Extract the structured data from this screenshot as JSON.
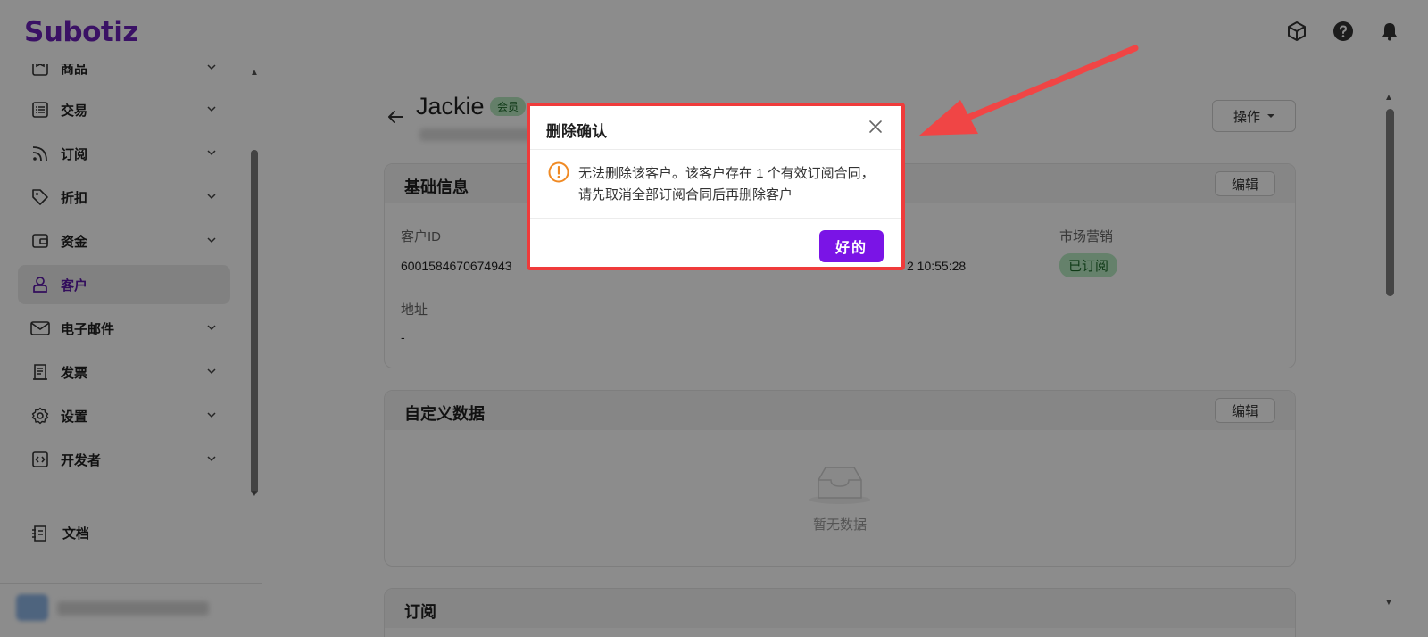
{
  "app": {
    "logo": "Subotiz"
  },
  "sidebar": {
    "items": [
      {
        "key": "products",
        "label": "商品",
        "icon": "product-icon"
      },
      {
        "key": "transactions",
        "label": "交易",
        "icon": "list-icon"
      },
      {
        "key": "subscriptions",
        "label": "订阅",
        "icon": "rss-icon"
      },
      {
        "key": "discounts",
        "label": "折扣",
        "icon": "tag-icon"
      },
      {
        "key": "funds",
        "label": "资金",
        "icon": "wallet-icon"
      },
      {
        "key": "customers",
        "label": "客户",
        "icon": "user-icon",
        "active": true
      },
      {
        "key": "email",
        "label": "电子邮件",
        "icon": "mail-icon"
      },
      {
        "key": "invoices",
        "label": "发票",
        "icon": "invoice-icon"
      },
      {
        "key": "settings",
        "label": "设置",
        "icon": "gear-icon"
      },
      {
        "key": "developer",
        "label": "开发者",
        "icon": "code-icon"
      }
    ],
    "docs_label": "文档"
  },
  "customer": {
    "name": "Jackie",
    "member_tag": "会员",
    "ops_label": "操作"
  },
  "basic_info": {
    "title": "基础信息",
    "edit_label": "编辑",
    "id_label": "客户ID",
    "id_value": "6001584670674943",
    "time_value": "2 10:55:28",
    "marketing_label": "市场营销",
    "marketing_value": "已订阅",
    "address_label": "地址",
    "address_value": "-"
  },
  "custom_data": {
    "title": "自定义数据",
    "edit_label": "编辑",
    "empty_text": "暂无数据"
  },
  "subscriptions_card": {
    "title": "订阅"
  },
  "modal": {
    "title": "删除确认",
    "message": "无法删除该客户。该客户存在 1 个有效订阅合同，请先取消全部订阅合同后再删除客户",
    "ok_label": "好的"
  },
  "colors": {
    "brand": "#6b1fb8",
    "primary_button": "#7a14e6",
    "highlight_border": "#ef3b3b",
    "warning": "#f08a24",
    "success_tag": "#b9ecc4"
  }
}
